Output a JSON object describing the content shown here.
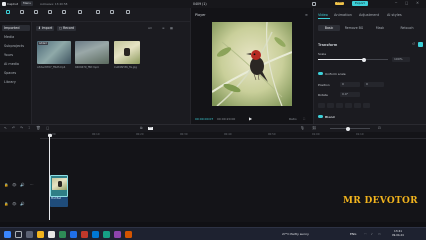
{
  "app": {
    "title": "CapCut",
    "menu_label": "Menu",
    "autosave_text": "Autosave: 13:40:58",
    "project_name": "0409 (1)",
    "pro_badge": "PRO",
    "export_label": "Export"
  },
  "toolbar": {
    "tools": [
      {
        "label": "Media",
        "active": true
      },
      {
        "label": "Audio",
        "active": false
      },
      {
        "label": "Text",
        "active": false
      },
      {
        "label": "Stickers",
        "active": false
      },
      {
        "label": "Effects",
        "active": false
      },
      {
        "label": "Transitions",
        "active": false
      },
      {
        "label": "Captions",
        "active": false
      },
      {
        "label": "Filters",
        "active": false
      },
      {
        "label": "Adjustment",
        "active": false
      }
    ]
  },
  "sidebar": {
    "items": [
      "Imported",
      "Media",
      "Subprojects",
      "Yours",
      "AI media",
      "Spaces",
      "Library"
    ]
  },
  "media": {
    "import_label": "Import",
    "record_label": "Record",
    "sort_label": "All",
    "files": [
      {
        "caption": "A3dec8707_ffbdf.mp4",
        "badge": "Added"
      },
      {
        "caption": "0409479_ffbf.mp4",
        "badge": ""
      },
      {
        "caption": "CuR9SH36_fG.jpg",
        "badge": ""
      }
    ]
  },
  "player": {
    "title": "Player",
    "time_current": "00:00:00:07",
    "time_total": "00:00:20:00",
    "ratio_label": "Ratio"
  },
  "props": {
    "tabs": [
      "Video",
      "Animation",
      "Adjustment",
      "AI styles"
    ],
    "subtabs": [
      "Basic",
      "Remove BG",
      "Mask",
      "Retouch"
    ],
    "transform_label": "Transform",
    "scale_label": "Scale",
    "scale_value": "100%",
    "uniform_scale_label": "Uniform scale",
    "position_label": "Position",
    "pos_x": "0",
    "pos_y": "0",
    "rotate_label": "Rotate",
    "rotate_value": "0.0°",
    "blend_label": "Blend"
  },
  "timeline": {
    "ticks": [
      "00:00",
      "00:10",
      "00:20",
      "00:30",
      "00:40",
      "00:50",
      "01:00",
      "01:10"
    ],
    "clip_label": "Modified"
  },
  "taskbar": {
    "weather": "27°C Partly sunny",
    "time": "13:41",
    "date": "09-04-24",
    "lang": "ENG"
  },
  "watermark": "MR DEVOTOR",
  "colors": {
    "accent": "#3dd0d8",
    "brand_watermark": "#f2b41d"
  }
}
